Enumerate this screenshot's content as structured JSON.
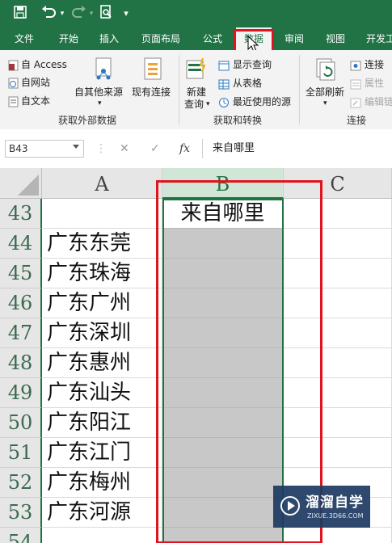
{
  "quick_access": {
    "more": "▾"
  },
  "tabs": [
    {
      "label": "文件"
    },
    {
      "label": "开始"
    },
    {
      "label": "插入"
    },
    {
      "label": "页面布局"
    },
    {
      "label": "公式"
    },
    {
      "label": "数据",
      "active": true
    },
    {
      "label": "审阅"
    },
    {
      "label": "视图"
    },
    {
      "label": "开发工"
    }
  ],
  "ribbon": {
    "get_external": {
      "access": "自 Access",
      "web": "自网站",
      "text": "自文本",
      "other": "自其他来源",
      "existing": "现有连接",
      "group": "获取外部数据"
    },
    "transform": {
      "new_query": "新建",
      "new_query2": "查询",
      "show_queries": "显示查询",
      "from_table": "从表格",
      "recent": "最近使用的源",
      "group": "获取和转换"
    },
    "connections": {
      "refresh_all": "全部刷新",
      "connections": "连接",
      "properties": "属性",
      "edit_links": "编辑链",
      "group": "连接"
    }
  },
  "formula_bar": {
    "name_box": "B43",
    "cancel": "✕",
    "enter": "✓",
    "fx": "fx",
    "value": "来自哪里"
  },
  "sheet": {
    "columns": [
      "A",
      "B",
      "C"
    ],
    "rows": [
      {
        "num": "43",
        "a": "",
        "b": "来自哪里"
      },
      {
        "num": "44",
        "a": "广东东莞",
        "b": ""
      },
      {
        "num": "45",
        "a": "广东珠海",
        "b": ""
      },
      {
        "num": "46",
        "a": "广东广州",
        "b": ""
      },
      {
        "num": "47",
        "a": "广东深圳",
        "b": ""
      },
      {
        "num": "48",
        "a": "广东惠州",
        "b": ""
      },
      {
        "num": "49",
        "a": "广东汕头",
        "b": ""
      },
      {
        "num": "50",
        "a": "广东阳江",
        "b": ""
      },
      {
        "num": "51",
        "a": "广东江门",
        "b": ""
      },
      {
        "num": "52",
        "a": "广东梅州",
        "b": ""
      },
      {
        "num": "53",
        "a": "广东河源",
        "b": ""
      },
      {
        "num": "54",
        "a": "",
        "b": ""
      }
    ]
  },
  "watermark": {
    "title": "溜溜自学",
    "url": "ZIXUE.3D66.COM"
  },
  "colors": {
    "excel_green": "#217346",
    "highlight_red": "#e0141e",
    "selected_fill": "#c8c8c8"
  }
}
